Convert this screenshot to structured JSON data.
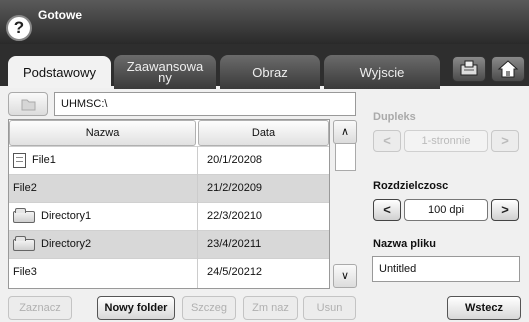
{
  "header": {
    "title": "Gotowe",
    "help_icon": "?"
  },
  "tabs": [
    {
      "label": "Podstawowy",
      "active": true
    },
    {
      "label": "Zaawansowany",
      "line1": "Zaawansowa",
      "line2": "ny",
      "active": false
    },
    {
      "label": "Obraz",
      "active": false
    },
    {
      "label": "Wyjscie",
      "active": false
    }
  ],
  "path": {
    "value": "UHMSC:\\"
  },
  "table": {
    "columns": [
      "Nazwa",
      "Data"
    ],
    "rows": [
      {
        "name": "File1",
        "date": "20/1/20208",
        "icon": "file-icon"
      },
      {
        "name": "File2",
        "date": "21/2/20209",
        "icon": ""
      },
      {
        "name": "Directory1",
        "date": "22/3/20210",
        "icon": "folder-icon"
      },
      {
        "name": "Directory2",
        "date": "23/4/20211",
        "icon": "folder-icon"
      },
      {
        "name": "File3",
        "date": "24/5/20212",
        "icon": ""
      }
    ]
  },
  "buttons": {
    "zaznacz": "Zaznacz",
    "nowy_folder": "Nowy folder",
    "szczeg": "Szczeg",
    "zmnaz": "Zm naz",
    "usun": "Usun",
    "wstecz": "Wstecz"
  },
  "duplex": {
    "label": "Dupleks",
    "value": "1-stronnie",
    "enabled": false
  },
  "resolution": {
    "label": "Rozdzielczosc",
    "value": "100 dpi"
  },
  "filename": {
    "label": "Nazwa pliku",
    "value": "Untitled"
  },
  "scroll_arrows": {
    "up": "∧",
    "down": "∨"
  },
  "arrows": {
    "left": "<",
    "right": ">"
  }
}
